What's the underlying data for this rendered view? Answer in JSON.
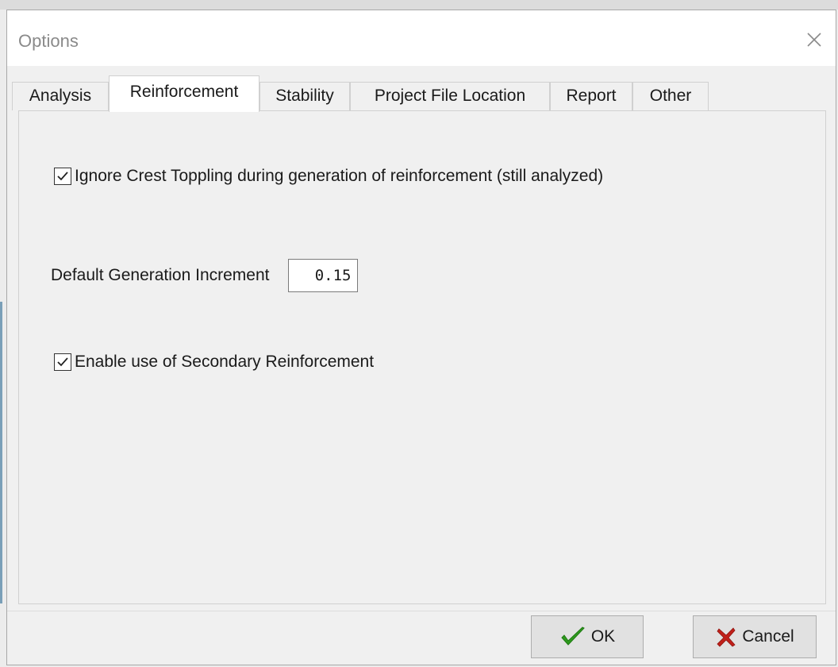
{
  "window": {
    "title": "Options",
    "close_icon": "close-icon"
  },
  "tabs": [
    {
      "label": "Analysis",
      "active": false
    },
    {
      "label": "Reinforcement",
      "active": true
    },
    {
      "label": "Stability",
      "active": false
    },
    {
      "label": "Project File Location",
      "active": false
    },
    {
      "label": "Report",
      "active": false
    },
    {
      "label": "Other",
      "active": false
    }
  ],
  "reinforcement": {
    "ignore_crest_toppling": {
      "label": "Ignore Crest Toppling during generation of reinforcement (still analyzed)",
      "checked": true
    },
    "default_generation_increment": {
      "label": "Default Generation Increment",
      "value": "0.15"
    },
    "enable_secondary": {
      "label": "Enable use of Secondary Reinforcement",
      "checked": true
    }
  },
  "buttons": {
    "ok_label": "OK",
    "ok_icon": "checkmark-icon",
    "ok_icon_color": "#2e9a1e",
    "cancel_label": "Cancel",
    "cancel_icon": "x-icon",
    "cancel_icon_color": "#c0201a"
  }
}
